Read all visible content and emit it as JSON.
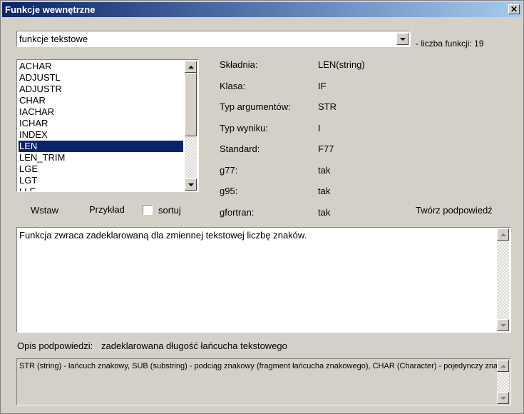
{
  "window": {
    "title": "Funkcje wewnętrzne"
  },
  "category": {
    "selected": "funkcje tekstowe",
    "count_label": "- liczba funkcji: 19"
  },
  "functions": {
    "items": [
      "ACHAR",
      "ADJUSTL",
      "ADJUSTR",
      "CHAR",
      "IACHAR",
      "ICHAR",
      "INDEX",
      "LEN",
      "LEN_TRIM",
      "LGE",
      "LGT",
      "LLE"
    ],
    "selected": "LEN"
  },
  "details": [
    {
      "label": "Składnia:",
      "value": "LEN(string)"
    },
    {
      "label": "Klasa:",
      "value": "IF"
    },
    {
      "label": "Typ argumentów:",
      "value": "STR"
    },
    {
      "label": "Typ wyniku:",
      "value": "I"
    },
    {
      "label": "Standard:",
      "value": "F77"
    },
    {
      "label": "g77:",
      "value": "tak"
    },
    {
      "label": "g95:",
      "value": "tak"
    },
    {
      "label": "gfortran:",
      "value": "tak"
    }
  ],
  "actions": {
    "insert": "Wstaw",
    "example": "Przykład",
    "sort": "sortuj",
    "create_hint": "Twórz podpowiedź"
  },
  "description": {
    "text": "Funkcja zwraca zadeklarowaną dla zmiennej tekstowej liczbę znaków."
  },
  "hint": {
    "label": "Opis podpowiedzi:",
    "text": "zadeklarowana długość łańcucha tekstowego"
  },
  "arg_legend": {
    "text": "STR (string) - łańcuch znakowy, SUB (substring) - podciąg znakowy (fragment łańcucha znakowego), CHAR (Character) - pojedynczy znak."
  },
  "colors": {
    "title_start": "#0a246a",
    "title_end": "#a6caf0",
    "selection": "#0a246a",
    "face": "#d4d0c8"
  }
}
